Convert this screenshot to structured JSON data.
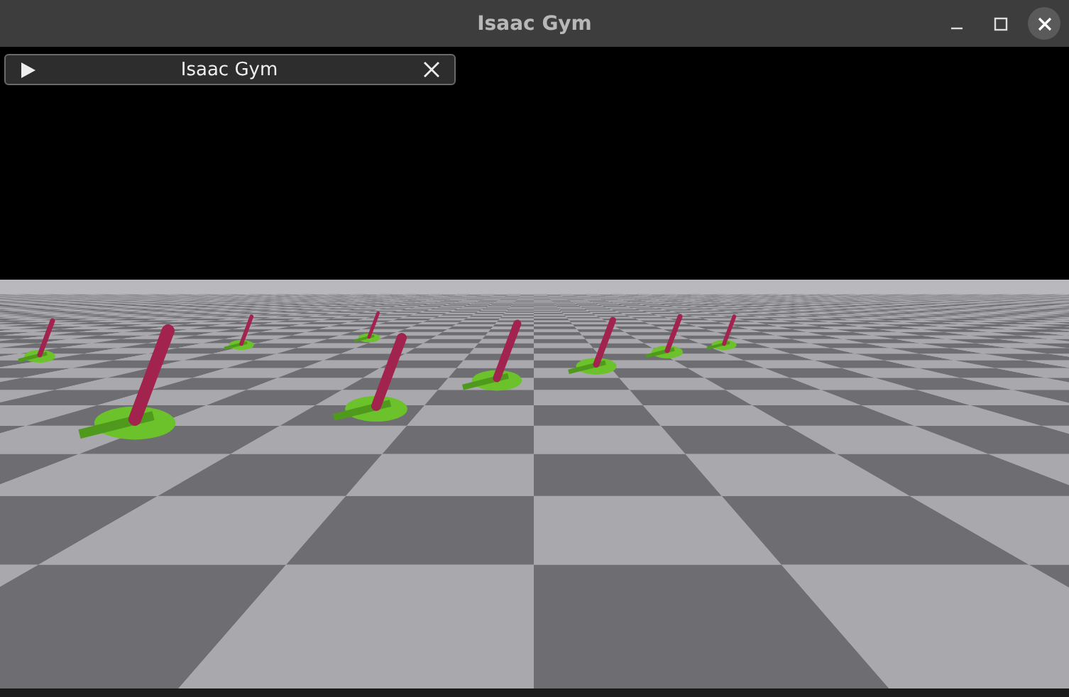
{
  "window": {
    "title": "Isaac Gym",
    "controls": [
      {
        "kind": "minimize"
      },
      {
        "kind": "maximize"
      },
      {
        "kind": "close"
      }
    ]
  },
  "panel": {
    "title": "Isaac Gym",
    "expanded": false
  }
}
